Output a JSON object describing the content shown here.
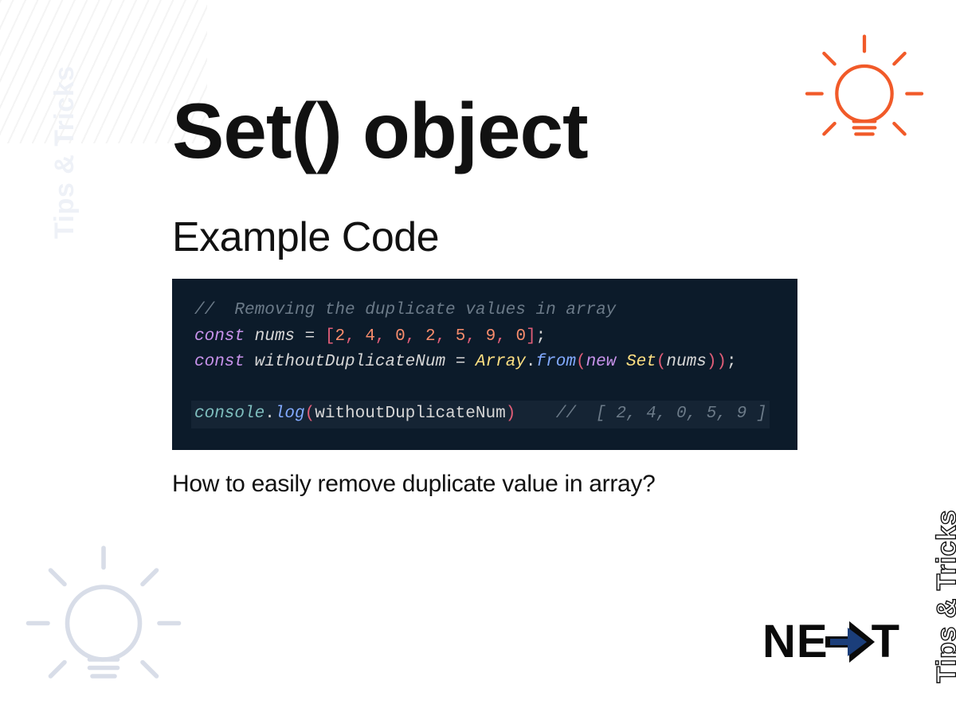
{
  "badges": {
    "tips_label": "Tips & Tricks"
  },
  "content": {
    "title": "Set() object",
    "subtitle": "Example Code",
    "question": "How to easily remove duplicate value in array?"
  },
  "code": {
    "comment1": "//  Removing the duplicate values in array",
    "kw_const": "const",
    "ident_nums": "nums",
    "nums_values": [
      "2",
      "4",
      "0",
      "2",
      "5",
      "9",
      "0"
    ],
    "ident_withoutDup": "withoutDuplicateNum",
    "type_Array": "Array",
    "method_from": "from",
    "kw_new": "new",
    "type_Set": "Set",
    "obj_console": "console",
    "method_log": "log",
    "output_comment_prefix": "//  [ ",
    "output_values": [
      "2",
      "4",
      "0",
      "5",
      "9"
    ],
    "output_comment_suffix": " ]"
  },
  "logo": {
    "part_ne": "NE",
    "part_t": "T"
  }
}
